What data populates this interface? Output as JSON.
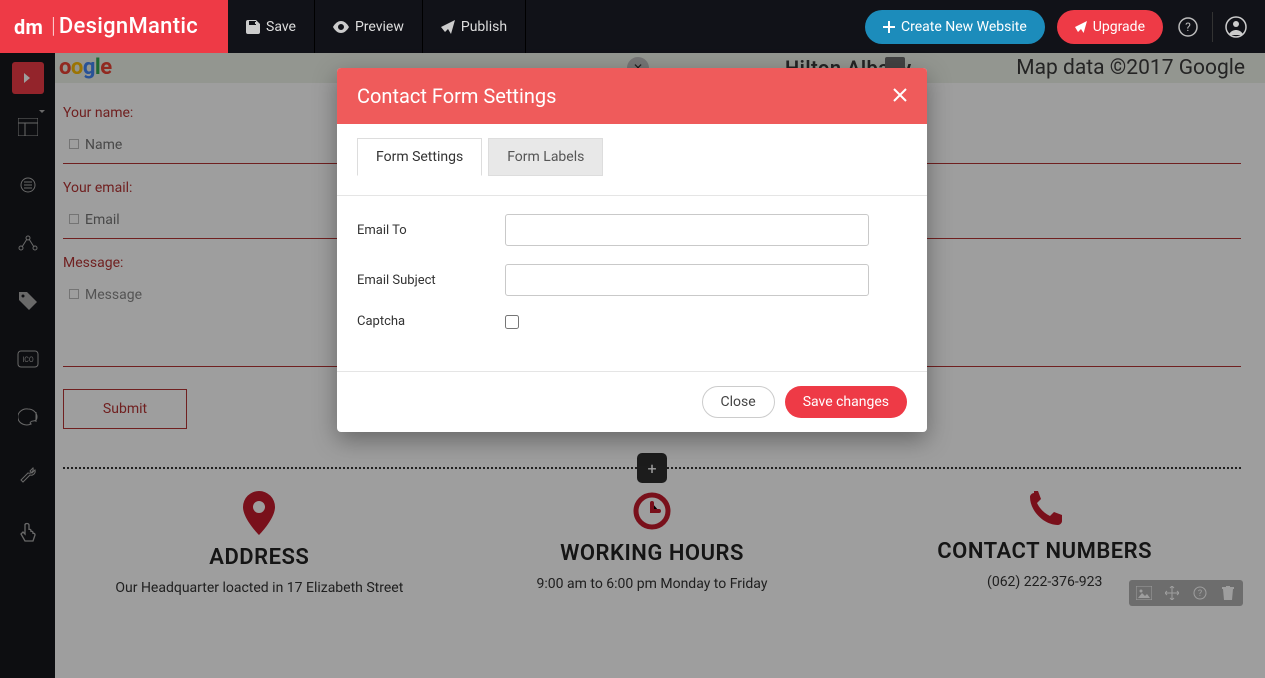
{
  "brand": {
    "name": "DesignMantic"
  },
  "top": {
    "save": "Save",
    "preview": "Preview",
    "publish": "Publish",
    "create": "Create New Website",
    "upgrade": "Upgrade"
  },
  "map": {
    "hilton": "Hilton Albany",
    "attribution": "Map data ©2017 Google"
  },
  "form": {
    "nameLabel": "Your name:",
    "namePH": "Name",
    "emailLabel": "Your email:",
    "emailPH": "Email",
    "messageLabel": "Message:",
    "messagePH": "Message",
    "submit": "Submit"
  },
  "info": {
    "addressTitle": "ADDRESS",
    "addressText": "Our Headquarter loacted in 17 Elizabeth Street",
    "hoursTitle": "WORKING HOURS",
    "hoursText": "9:00 am to 6:00 pm Monday to Friday",
    "contactTitle": "CONTACT NUMBERS",
    "contactText": "(062) 222-376-923"
  },
  "modal": {
    "title": "Contact Form Settings",
    "tabSettings": "Form Settings",
    "tabLabels": "Form Labels",
    "emailTo": "Email To",
    "emailSubject": "Email Subject",
    "captcha": "Captcha",
    "close": "Close",
    "save": "Save changes"
  }
}
